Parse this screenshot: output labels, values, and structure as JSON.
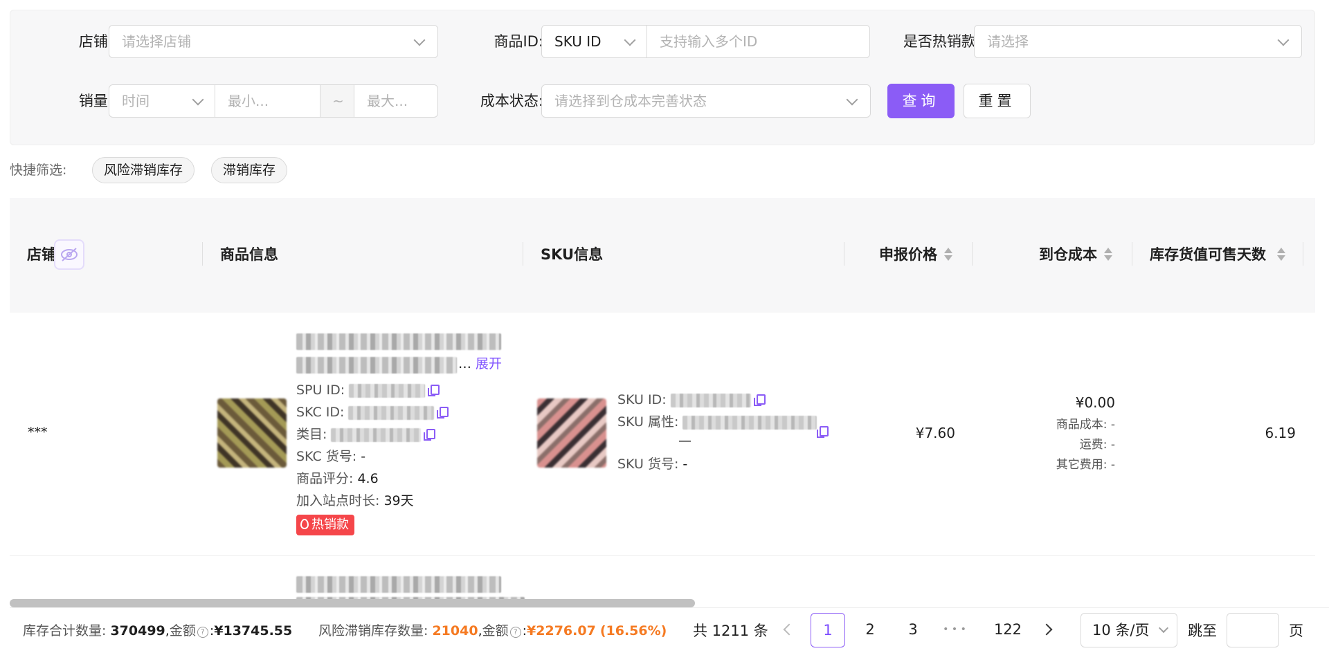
{
  "filters": {
    "shop_label": "店铺",
    "shop_placeholder": "请选择店铺",
    "product_id_label": "商品ID",
    "product_id_type": "SKU ID",
    "product_id_placeholder": "支持输入多个ID",
    "hot_label": "是否热销款",
    "hot_placeholder": "请选择",
    "sales_label": "销量",
    "sales_time_placeholder": "时间",
    "sales_min_placeholder": "最小...",
    "sales_range_sep": "~",
    "sales_max_placeholder": "最大...",
    "cost_status_label": "成本状态",
    "cost_status_placeholder": "请选择到仓成本完善状态",
    "search_button": "查询",
    "reset_button": "重置"
  },
  "quick_filter": {
    "label": "快捷筛选:",
    "chips": [
      "风险滞销库存",
      "滞销库存"
    ]
  },
  "table": {
    "columns": [
      "店铺",
      "商品信息",
      "SKU信息",
      "申报价格",
      "到仓成本",
      "库存货值可售天数"
    ],
    "rows": [
      {
        "shop": "***",
        "expand_link": "展开",
        "spu_id_label": "SPU ID:",
        "skc_id_label": "SKC ID:",
        "category_label": "类目:",
        "skc_no_label": "SKC 货号:",
        "skc_no_value": "-",
        "rating_label": "商品评分:",
        "rating_value": "4.6",
        "site_days_label": "加入站点时长:",
        "site_days_value": "39天",
        "hot_tag": "热销款",
        "sku_id_label": "SKU ID:",
        "sku_attr_label": "SKU 属性:",
        "sku_attr_extra": "—",
        "sku_no_label": "SKU 货号:",
        "sku_no_value": "-",
        "declared_price": "¥7.60",
        "arrival_cost": "¥0.00",
        "product_cost_label": "商品成本:",
        "product_cost_value": "-",
        "shipping_label": "运费:",
        "shipping_value": "-",
        "other_fee_label": "其它费用:",
        "other_fee_value": "-",
        "sellable_days": "6.19"
      }
    ]
  },
  "footer": {
    "stock_total_label": "库存合计数量:",
    "stock_total_value": "370499",
    "amount_label": "金额",
    "stock_amount_value": "¥13745.55",
    "risk_label": "风险滞销库存数量:",
    "risk_value": "21040",
    "risk_amount_value": "¥2276.07",
    "risk_percent": "(16.56%)",
    "total_text": "共 1211 条",
    "pages": [
      "1",
      "2",
      "3",
      "122"
    ],
    "ellipsis": "• • •",
    "current_page": "1",
    "page_size": "10 条/页",
    "jump_label": "跳至",
    "page_suffix": "页"
  },
  "colors": {
    "primary": "#8b5cf6",
    "warning": "#f57a22",
    "hot": "#f5464a"
  }
}
